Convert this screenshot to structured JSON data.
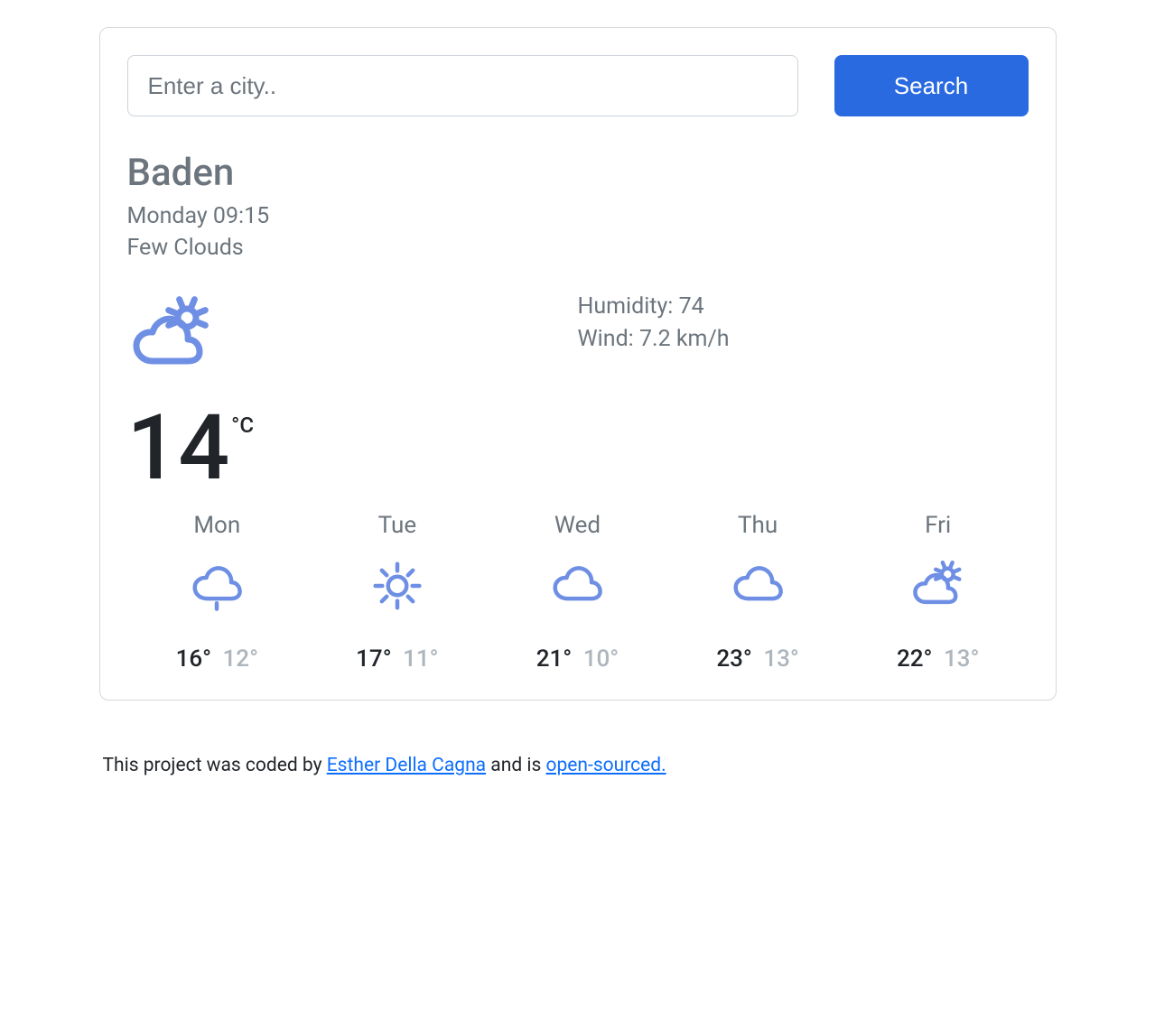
{
  "search": {
    "placeholder": "Enter a city..",
    "button_label": "Search"
  },
  "overview": {
    "city": "Baden",
    "date": "Monday 09:15",
    "description": "Few Clouds",
    "icon": "cloud-sun"
  },
  "current": {
    "temp": "14",
    "unit": "°C",
    "humidity_label": "Humidity:",
    "humidity_value": "74",
    "wind_label": "Wind:",
    "wind_value": "7.2",
    "wind_unit": "km/h"
  },
  "forecast": [
    {
      "day": "Mon",
      "icon": "cloud-rain",
      "max": "16°",
      "min": "12°"
    },
    {
      "day": "Tue",
      "icon": "sun",
      "max": "17°",
      "min": "11°"
    },
    {
      "day": "Wed",
      "icon": "cloud",
      "max": "21°",
      "min": "10°"
    },
    {
      "day": "Thu",
      "icon": "cloud",
      "max": "23°",
      "min": "13°"
    },
    {
      "day": "Fri",
      "icon": "cloud-sun",
      "max": "22°",
      "min": "13°"
    }
  ],
  "footer": {
    "prefix": "This project was coded by ",
    "author": "Esther Della Cagna",
    "middle": " and is ",
    "source": "open-sourced."
  },
  "colors": {
    "iconStroke": "#6e8fe4",
    "accent": "#2a6ae0"
  }
}
